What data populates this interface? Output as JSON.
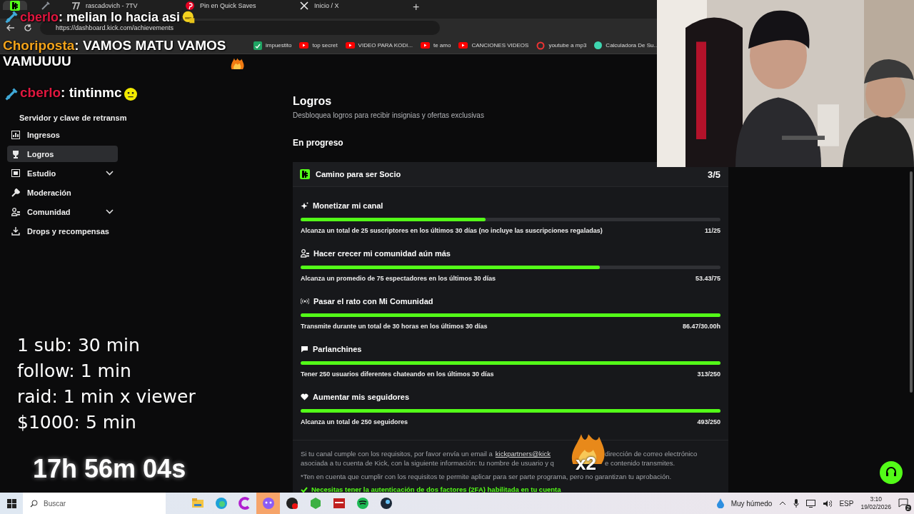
{
  "browser": {
    "tabs": [
      {
        "kind": "kick",
        "selected": true
      },
      {
        "kind": "sword",
        "selected": false
      },
      {
        "kind": "seventv",
        "title": "rascadovich - 7TV",
        "selected": false
      },
      {
        "kind": "pinterest",
        "title": "Pin en Quick Saves",
        "selected": false
      },
      {
        "kind": "x",
        "title": "Inicio / X",
        "selected": false
      }
    ],
    "new_tab": "+",
    "address": "https://dashboard.kick.com/achievements",
    "bookmarks": [
      {
        "kind": "sheet",
        "label": "impuestito"
      },
      {
        "kind": "youtube",
        "label": "top secret"
      },
      {
        "kind": "youtube",
        "label": "VIDEO PARA KODI..."
      },
      {
        "kind": "youtube",
        "label": "te amo"
      },
      {
        "kind": "youtube",
        "label": "CANCIONES VIDEOS"
      },
      {
        "kind": "ring",
        "label": "youtube a mp3"
      },
      {
        "kind": "dot",
        "label": "Calculadora De Su..."
      }
    ]
  },
  "sidebar": {
    "sub_item": "Servidor y clave de retransm",
    "items": [
      {
        "kind": "chart",
        "label": "Ingresos",
        "selected": false,
        "submenu": false
      },
      {
        "kind": "trophy",
        "label": "Logros",
        "selected": true,
        "submenu": false
      },
      {
        "kind": "film",
        "label": "Estudio",
        "selected": false,
        "submenu": true
      },
      {
        "kind": "wrench",
        "label": "Moderación",
        "selected": false,
        "submenu": false
      },
      {
        "kind": "people",
        "label": "Comunidad",
        "selected": false,
        "submenu": true
      },
      {
        "kind": "drops",
        "label": "Drops y recompensas",
        "selected": false,
        "submenu": false
      }
    ]
  },
  "achievements": {
    "title": "Logros",
    "subtitle": "Desbloquea logros para recibir insignias y ofertas exclusivas",
    "section": "En progreso",
    "card": {
      "title": "Camino para ser Socio",
      "count": "3/5",
      "goals": [
        {
          "kind": "sparkle",
          "title": "Monetizar mi canal",
          "description": "Alcanza un total de 25 suscriptores en los últimos 30 días (no incluye las suscripciones regaladas)",
          "value": "11/25",
          "level": 0.44
        },
        {
          "kind": "people",
          "title": "Hacer crecer mi comunidad aún más",
          "description": "Alcanza un promedio de 75 espectadores en los últimos 30 días",
          "value": "53.43/75",
          "level": 0.712
        },
        {
          "kind": "broadcast",
          "title": "Pasar el rato con Mi Comunidad",
          "description": "Transmite durante un total de 30 horas en los últimos 30 días",
          "value": "86.47/30.00h",
          "level": 1
        },
        {
          "kind": "chat",
          "title": "Parlanchines",
          "description": "Tener 250 usuarios diferentes chateando en los últimos 30 días",
          "value": "313/250",
          "level": 1
        },
        {
          "kind": "heart",
          "title": "Aumentar mis seguidores",
          "description": "Alcanza un total de 250 seguidores",
          "value": "493/250",
          "level": 1
        }
      ]
    },
    "footer": {
      "lines": [
        {
          "before": "Si tu canal cumple con los requisitos, por favor envía un email a",
          "link": "kickpartners@kick",
          "after": "dirección de correo electrónico"
        },
        {
          "before": "asociada a tu cuenta de Kick, con la siguiente información: tu nombre de usuario y q",
          "after": "e contenido transmites."
        }
      ],
      "note": "*Ten en cuenta que cumplir con los requisitos te permite aplicar para ser parte programa, pero no garantizan tu aprobación.",
      "check": "Necesitas tener la autenticación de dos factores (2FA) habilitada en tu cuenta"
    }
  },
  "overlay": {
    "chat": [
      {
        "user": "cberlo",
        "color": "#e0173f",
        "badge": true,
        "text": ": melian lo hacia asi",
        "kind": "grin"
      },
      {
        "user": "Choriposta",
        "color": "#f2a31b",
        "badge": false,
        "text": ": VAMOS MATU VAMOS VAMUUUU",
        "kind": "fire"
      },
      {
        "user": "cberlo",
        "color": "#e0173f",
        "badge": true,
        "text": ": tintinmc",
        "kind": "neutral"
      }
    ],
    "rules": [
      "1 sub: 30 min",
      "follow: 1 min",
      "raid: 1 min x viewer",
      "$1000: 5 min"
    ],
    "timer": "17h 56m 04s",
    "webcam": {
      "kind": "picture"
    },
    "emote_badge": "x2"
  },
  "taskbar": {
    "search_placeholder": "Buscar",
    "apps": [
      {
        "kind": "folder",
        "active": false
      },
      {
        "kind": "edge",
        "active": false
      },
      {
        "kind": "letter-c",
        "active": false
      },
      {
        "kind": "chat-bubble",
        "active": true
      },
      {
        "kind": "record",
        "active": false
      },
      {
        "kind": "cube",
        "active": false
      },
      {
        "kind": "mixer",
        "active": false
      },
      {
        "kind": "spotify",
        "active": false
      },
      {
        "kind": "steam",
        "active": false
      }
    ],
    "weather": "Muy húmedo",
    "language": "ESP",
    "time": "3:10",
    "date": "19/02/2026",
    "notifications": "2"
  }
}
